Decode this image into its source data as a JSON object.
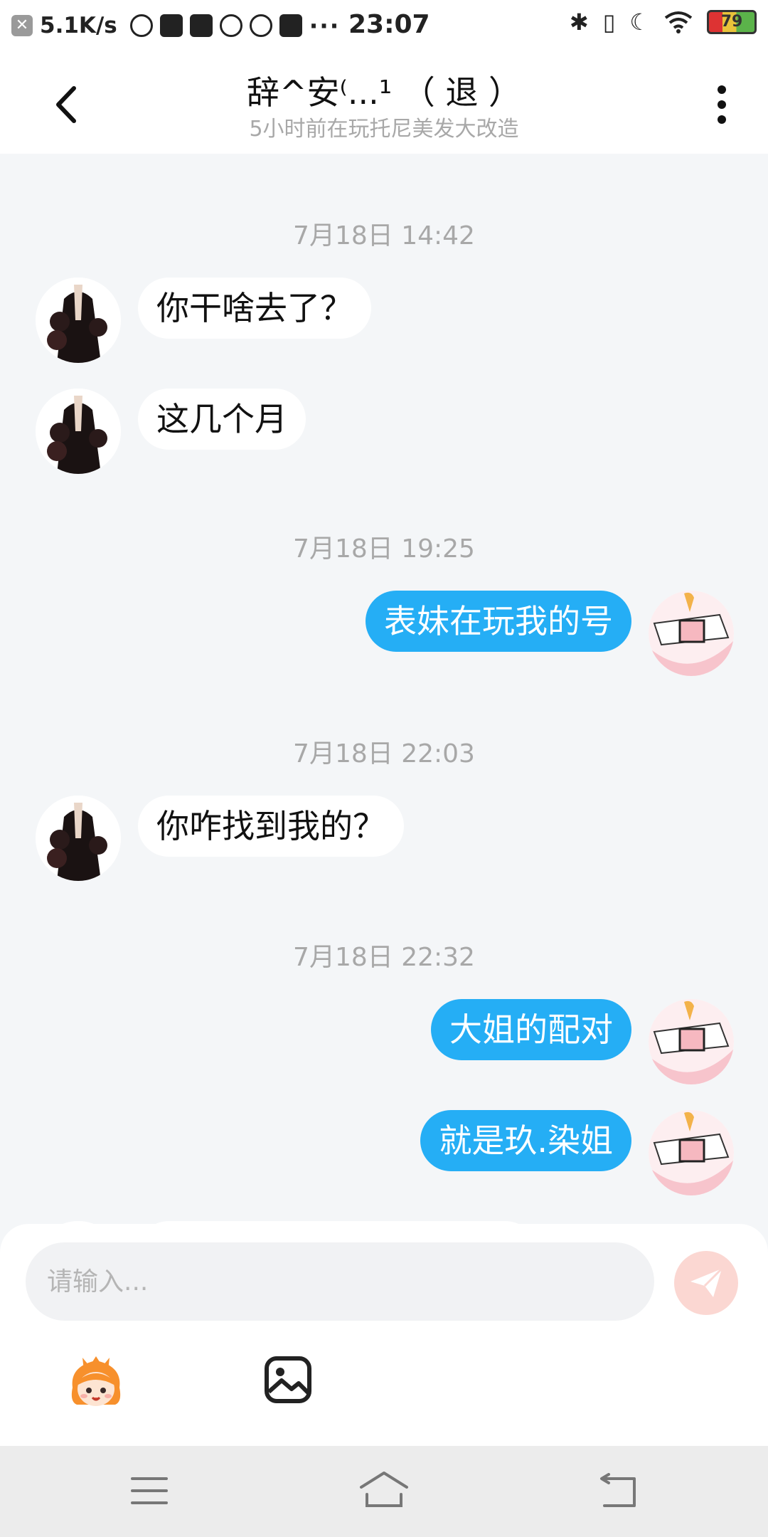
{
  "status_bar": {
    "speed": "5.1K/s",
    "more": "···",
    "time": "23:07",
    "battery": "79"
  },
  "header": {
    "title": "辞^安⁽...¹ （ 退 ）",
    "subtitle": "5小时前在玩托尼美发大改造"
  },
  "chat": {
    "ts1": "7月18日 14:42",
    "m1": "你干啥去了？",
    "m2": "这几个月",
    "ts2": "7月18日 19:25",
    "m3": "表妹在玩我的号",
    "ts3": "7月18日 22:03",
    "m4": "你咋找到我的？",
    "ts4": "7月18日 22:32",
    "m5": "大姐的配对",
    "m6": "就是玖.染姐"
  },
  "composer": {
    "placeholder": "请输入..."
  },
  "colors": {
    "accent": "#25aef5",
    "send_disabled": "#fbd7d2",
    "background": "#f4f6f8"
  },
  "icons": {
    "back": "chevron-left-icon",
    "more": "more-vertical-icon",
    "send": "send-icon",
    "sticker": "sticker-icon",
    "image": "image-icon",
    "nav_menu": "menu-icon",
    "nav_home": "home-icon",
    "nav_back": "back-icon"
  }
}
